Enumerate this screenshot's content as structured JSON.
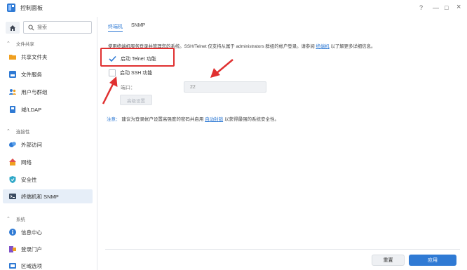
{
  "window": {
    "title": "控制面板",
    "help": "?",
    "minimize": "—",
    "maximize": "□",
    "close": "×"
  },
  "sidebar": {
    "search_placeholder": "搜索",
    "sections": [
      {
        "label": "文件共享"
      },
      {
        "label": "连接性"
      },
      {
        "label": "系统"
      }
    ],
    "items": [
      {
        "label": "共享文件夹",
        "icon": "shared-folder-icon"
      },
      {
        "label": "文件服务",
        "icon": "file-services-icon"
      },
      {
        "label": "用户与群组",
        "icon": "users-icon"
      },
      {
        "label": "域/LDAP",
        "icon": "domain-icon"
      },
      {
        "label": "外部访问",
        "icon": "external-access-icon"
      },
      {
        "label": "网络",
        "icon": "network-icon"
      },
      {
        "label": "安全性",
        "icon": "security-icon"
      },
      {
        "label": "终端机和 SNMP",
        "icon": "terminal-icon"
      },
      {
        "label": "信息中心",
        "icon": "info-icon"
      },
      {
        "label": "登录门户",
        "icon": "login-portal-icon"
      },
      {
        "label": "区域选项",
        "icon": "region-icon"
      }
    ]
  },
  "main": {
    "tabs": [
      "终端机",
      "SNMP"
    ],
    "description": {
      "text": "使用终端机服务登录并管理您的系统。SSH/Telnet 仅支持从属于 administrators 群组的帐户登录。请参阅",
      "link": "终端机",
      "suffix": "以了解更多详细信息。"
    },
    "telnet_label": "启动 Telnet 功能",
    "ssh_label": "启动 SSH 功能",
    "port_label": "端口：",
    "port_value": "22",
    "advanced_button": "高级设置",
    "note": {
      "label": "注意：",
      "text": "建议为登录帐户设置高强度的密码并启用",
      "link": "自动封锁",
      "suffix": "以获得最强的系统安全性。"
    }
  },
  "footer": {
    "reset": "重置",
    "apply": "应用"
  },
  "colors": {
    "accent": "#2f7ad4",
    "highlight": "#e03030"
  }
}
